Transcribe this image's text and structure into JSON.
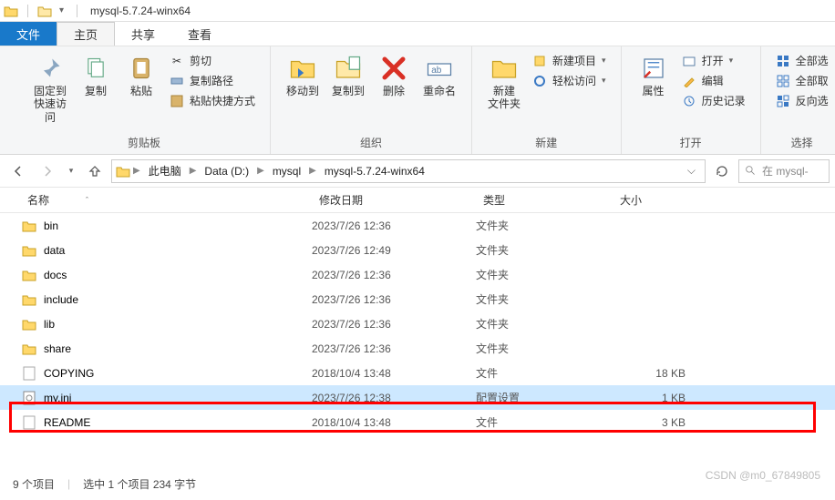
{
  "window": {
    "title": "mysql-5.7.24-winx64"
  },
  "tabs": {
    "file": "文件",
    "home": "主页",
    "share": "共享",
    "view": "查看"
  },
  "ribbon": {
    "clipboard": {
      "pin": "固定到\n快速访问",
      "copy": "复制",
      "paste": "粘贴",
      "cut": "剪切",
      "copypath": "复制路径",
      "pasteShortcut": "粘贴快捷方式",
      "label": "剪贴板"
    },
    "organize": {
      "moveto": "移动到",
      "copyto": "复制到",
      "delete": "删除",
      "rename": "重命名",
      "label": "组织"
    },
    "new": {
      "newfolder": "新建\n文件夹",
      "newitem": "新建项目",
      "easyaccess": "轻松访问",
      "label": "新建"
    },
    "open": {
      "properties": "属性",
      "open": "打开",
      "edit": "编辑",
      "history": "历史记录",
      "label": "打开"
    },
    "select": {
      "selectall": "全部选",
      "selectnone": "全部取",
      "invert": "反向选",
      "label": "选择"
    }
  },
  "breadcrumb": {
    "items": [
      "此电脑",
      "Data (D:)",
      "mysql",
      "mysql-5.7.24-winx64"
    ]
  },
  "search": {
    "placeholder": "在 mysql-"
  },
  "columns": {
    "name": "名称",
    "date": "修改日期",
    "type": "类型",
    "size": "大小"
  },
  "files": [
    {
      "name": "bin",
      "date": "2023/7/26 12:36",
      "type": "文件夹",
      "size": "",
      "kind": "folder"
    },
    {
      "name": "data",
      "date": "2023/7/26 12:49",
      "type": "文件夹",
      "size": "",
      "kind": "folder"
    },
    {
      "name": "docs",
      "date": "2023/7/26 12:36",
      "type": "文件夹",
      "size": "",
      "kind": "folder"
    },
    {
      "name": "include",
      "date": "2023/7/26 12:36",
      "type": "文件夹",
      "size": "",
      "kind": "folder"
    },
    {
      "name": "lib",
      "date": "2023/7/26 12:36",
      "type": "文件夹",
      "size": "",
      "kind": "folder"
    },
    {
      "name": "share",
      "date": "2023/7/26 12:36",
      "type": "文件夹",
      "size": "",
      "kind": "folder"
    },
    {
      "name": "COPYING",
      "date": "2018/10/4 13:48",
      "type": "文件",
      "size": "18 KB",
      "kind": "file"
    },
    {
      "name": "my.ini",
      "date": "2023/7/26 12:38",
      "type": "配置设置",
      "size": "1 KB",
      "kind": "ini",
      "selected": true
    },
    {
      "name": "README",
      "date": "2018/10/4 13:48",
      "type": "文件",
      "size": "3 KB",
      "kind": "file"
    }
  ],
  "status": {
    "count": "9 个项目",
    "selection": "选中 1 个项目  234 字节"
  },
  "watermark": "CSDN @m0_67849805"
}
